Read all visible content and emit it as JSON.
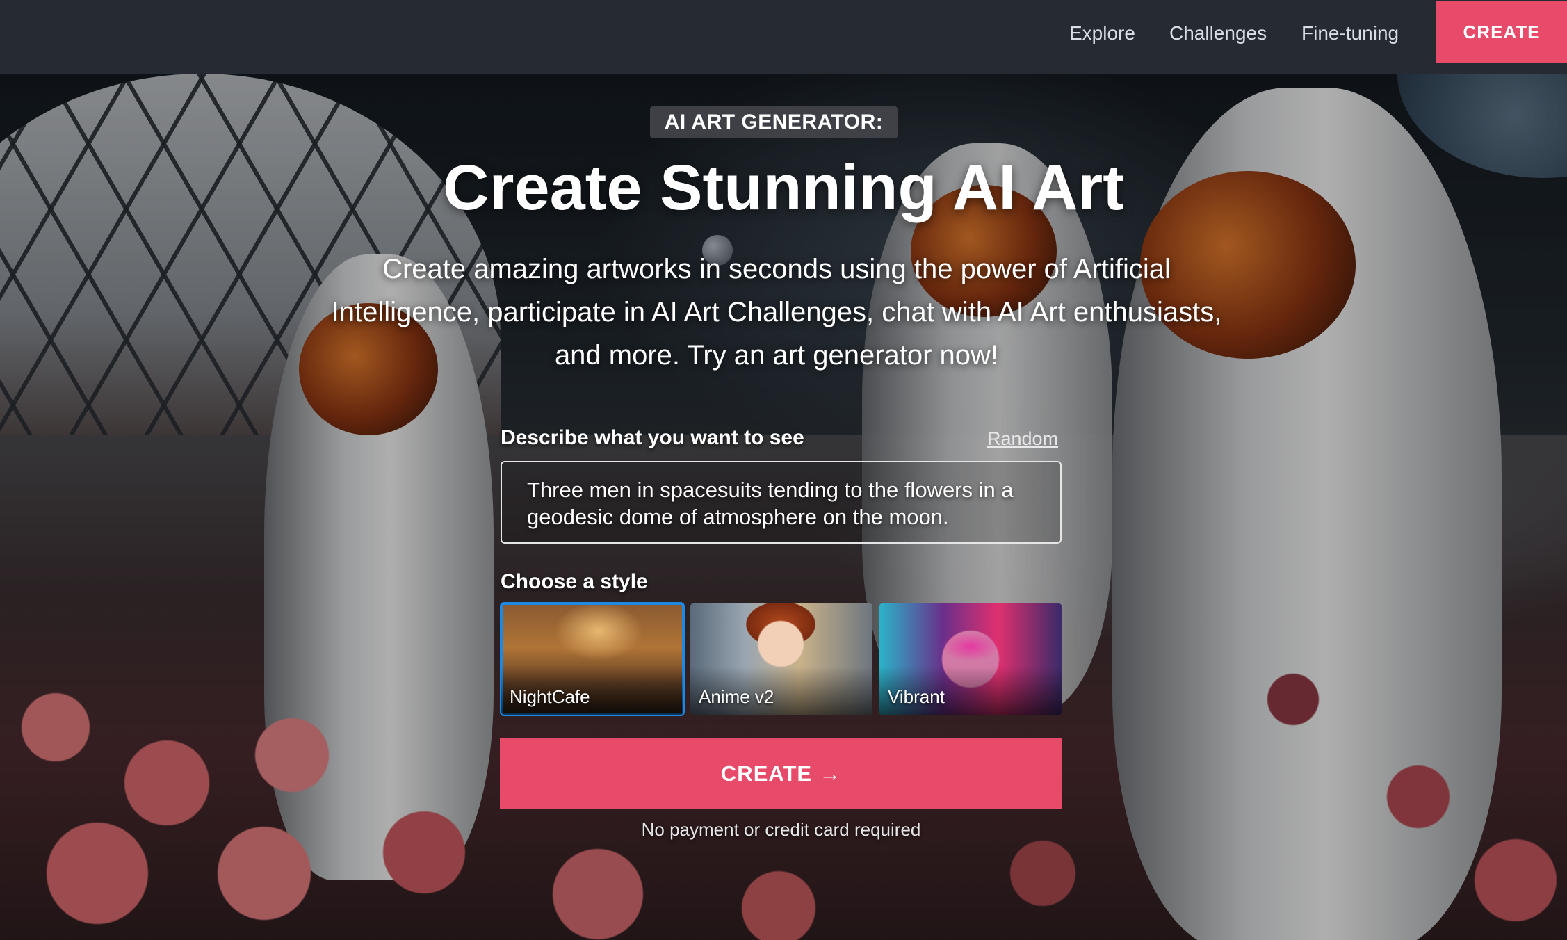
{
  "nav": {
    "links": [
      "Explore",
      "Challenges",
      "Fine-tuning"
    ],
    "create_label": "CREATE"
  },
  "hero": {
    "eyebrow": "AI ART GENERATOR:",
    "title": "Create Stunning AI Art",
    "subtitle": "Create amazing artworks in seconds using the power of Artificial Intelligence, participate in AI Art Challenges, chat with AI Art enthusiasts, and more. Try an art generator now!"
  },
  "prompt": {
    "label": "Describe what you want to see",
    "random_label": "Random",
    "value": "Three men in spacesuits tending to the flowers in a geodesic dome of atmosphere on the moon."
  },
  "styles": {
    "label": "Choose a style",
    "items": [
      "NightCafe",
      "Anime v2",
      "Vibrant"
    ],
    "selected": "NightCafe"
  },
  "cta": {
    "label": "CREATE",
    "arrow_icon": "arrow-right-icon",
    "disclaimer": "No payment or credit card required"
  },
  "colors": {
    "accent": "#e84b6a",
    "nav_bg": "#262a33",
    "selected_outline": "#1e88e5"
  }
}
